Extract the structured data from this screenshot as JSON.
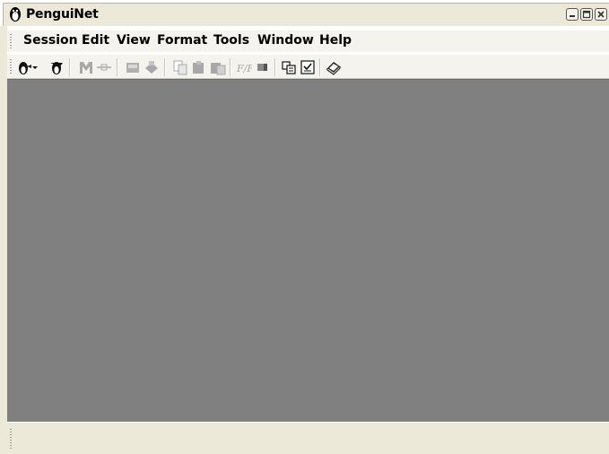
{
  "window": {
    "title": "PenguiNet"
  },
  "menu": {
    "items": [
      {
        "label": "Session"
      },
      {
        "label": "Edit"
      },
      {
        "label": "View"
      },
      {
        "label": "Format"
      },
      {
        "label": "Tools"
      },
      {
        "label": "Window"
      },
      {
        "label": "Help"
      }
    ]
  },
  "toolbar": {
    "buttons": [
      {
        "icon": "penguin-connect-icon",
        "enabled": true
      },
      {
        "icon": "dropdown-arrow-icon",
        "enabled": true
      },
      {
        "icon": "penguin-disconnect-icon",
        "enabled": true
      },
      {
        "icon": "sftp-icon",
        "enabled": false
      },
      {
        "icon": "port-forward-icon",
        "enabled": false
      },
      {
        "icon": "print-setup-icon",
        "enabled": false
      },
      {
        "icon": "print-icon",
        "enabled": false
      },
      {
        "icon": "copy-icon",
        "enabled": false
      },
      {
        "icon": "paste-icon",
        "enabled": false
      },
      {
        "icon": "copy-paste-icon",
        "enabled": false
      },
      {
        "icon": "font-icon",
        "enabled": false
      },
      {
        "icon": "color-icon",
        "enabled": false
      },
      {
        "icon": "profiles-icon",
        "enabled": true
      },
      {
        "icon": "options-icon",
        "enabled": true
      },
      {
        "icon": "help-book-icon",
        "enabled": true
      }
    ]
  },
  "colors": {
    "workspace": "#808080",
    "chrome": "#ece9d8",
    "toolbar": "#f4f3ee",
    "disabled_icon": "#a8a8a8"
  }
}
